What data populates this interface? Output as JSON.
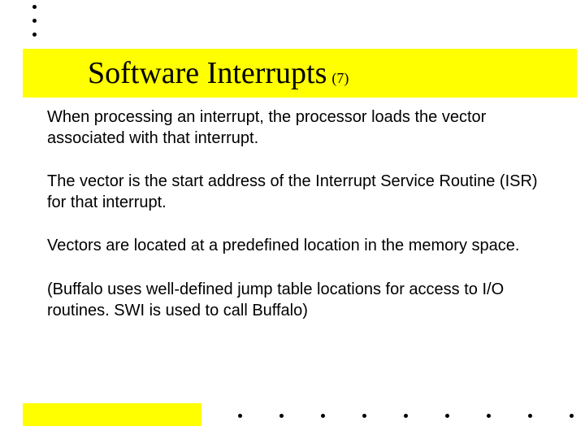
{
  "title": "Software Interrupts",
  "title_sub": "(7)",
  "paragraphs": [
    "When processing an interrupt, the processor loads the vector associated with that interrupt.",
    "The vector is the start address of the Interrupt Service Routine (ISR) for that interrupt.",
    "Vectors are located at a predefined location in the memory space.",
    "(Buffalo uses well-defined jump table locations for access to I/O routines. SWI is used to call Buffalo)"
  ]
}
